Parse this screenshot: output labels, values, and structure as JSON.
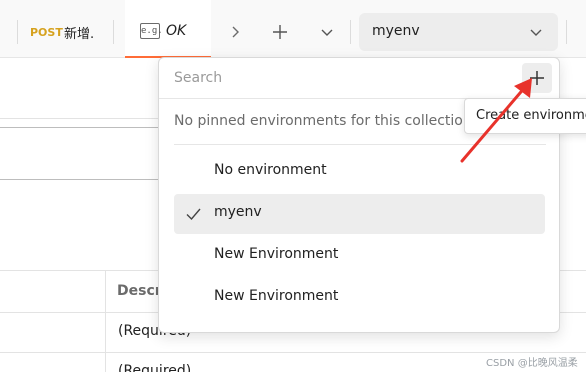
{
  "tabbar": {
    "tab_method": "POST",
    "tab_name": "新增.",
    "active_tab_label": "OK",
    "active_tab_icon": "example-icon",
    "active_tab_icon_text": "e.g.",
    "accent_color": "#ff6c37",
    "icons": [
      "chevron-right-icon",
      "plus-icon",
      "chevron-down-icon"
    ]
  },
  "environment_selector": {
    "selected": "myenv"
  },
  "dropdown": {
    "search_placeholder": "Search",
    "pinned_text": "No pinned environments for this collection",
    "items": [
      {
        "label": "No environment",
        "selected": false
      },
      {
        "label": "myenv",
        "selected": true
      },
      {
        "label": "New Environment",
        "selected": false
      },
      {
        "label": "New Environment",
        "selected": false
      }
    ]
  },
  "tooltip": {
    "text": "Create environment"
  },
  "background_page": {
    "column_header": "Description",
    "cells": [
      "(Required)",
      "(Required)"
    ]
  },
  "annotation": {
    "arrow_color": "#e8322b"
  },
  "watermark": "CSDN @比晚风温柔"
}
